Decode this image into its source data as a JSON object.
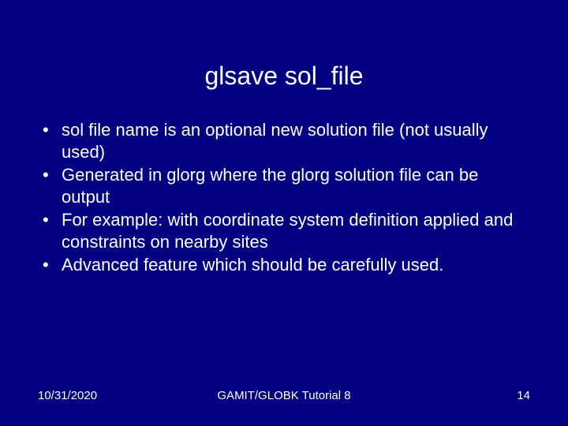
{
  "title": "glsave sol_file",
  "bullets": [
    " sol file name is an optional new solution file (not usually used)",
    "Generated in glorg where the glorg solution file can be output",
    "For example: with coordinate system definition applied and constraints on nearby sites",
    "Advanced feature which should be carefully used."
  ],
  "footer": {
    "date": "10/31/2020",
    "center": "GAMIT/GLOBK Tutorial 8",
    "page": "14"
  }
}
